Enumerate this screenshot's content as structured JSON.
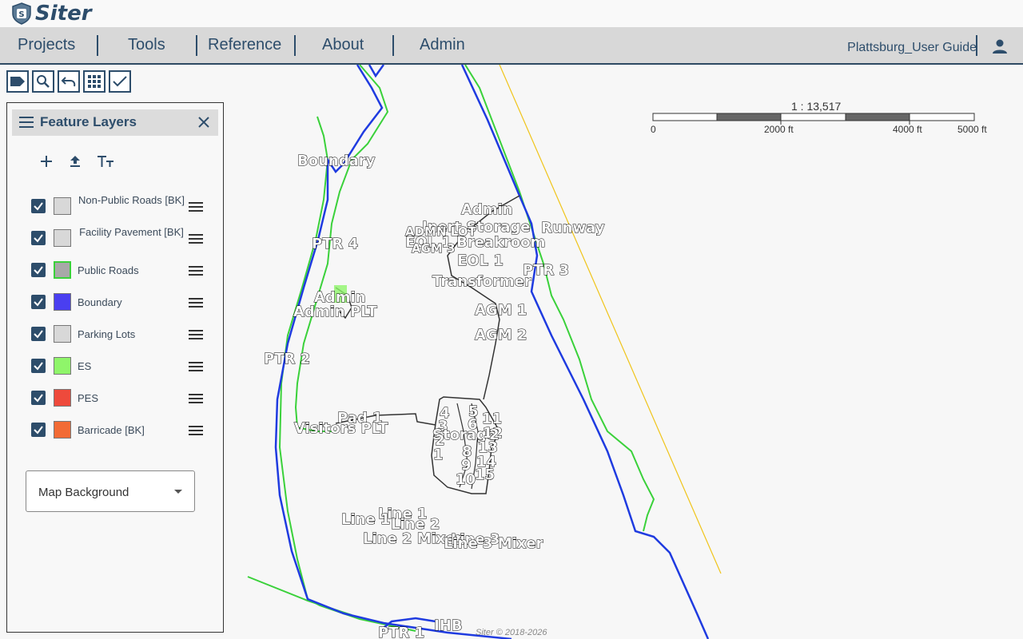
{
  "app": {
    "name": "Siter"
  },
  "nav": {
    "items": [
      {
        "id": "projects",
        "label": "Projects"
      },
      {
        "id": "tools",
        "label": "Tools"
      },
      {
        "id": "reference",
        "label": "Reference"
      },
      {
        "id": "about",
        "label": "About"
      },
      {
        "id": "admin",
        "label": "Admin"
      }
    ],
    "guide": "Plattsburg_User Guide"
  },
  "toolbar": {
    "icons": [
      "label-icon",
      "search-icon",
      "undo-icon",
      "grid-icon",
      "check-icon"
    ]
  },
  "panel": {
    "title": "Feature Layers",
    "layers": [
      {
        "label": "Non-Public Roads [BK]",
        "color": "#d8d8d8",
        "checked": true
      },
      {
        "label": "Facility Pavement [BK]",
        "color": "#d8d8d8",
        "checked": true
      },
      {
        "label": "Public Roads",
        "color": "#a8a8a8",
        "border": "#3ad13a",
        "checked": true
      },
      {
        "label": "Boundary",
        "color": "#4a3ff0",
        "checked": true
      },
      {
        "label": "Parking Lots",
        "color": "#d8d8d8",
        "checked": true
      },
      {
        "label": "ES",
        "color": "#8ff56a",
        "checked": true
      },
      {
        "label": "PES",
        "color": "#ee4a3c",
        "checked": true
      },
      {
        "label": "Barricade [BK]",
        "color": "#f26b35",
        "checked": true
      }
    ],
    "background_select": "Map Background"
  },
  "scale": {
    "ratio": "1 : 13,517",
    "labels": [
      "0",
      "2000 ft",
      "4000 ft",
      "5000 ft"
    ]
  },
  "map": {
    "labels": [
      "Boundary",
      "Admin",
      "Inert Storage",
      "Runway",
      "ADMN LOT",
      "EOL 1 Breakroom",
      "AGM 3",
      "EOL 1",
      "PTR 4",
      "PTR 3",
      "Transformer",
      "Admin",
      "Admin PLT",
      "AGM 1",
      "AGM 2",
      "PTR 2",
      "Pad 1",
      "Visitors PLT",
      "4",
      "5",
      "6",
      "11",
      "3",
      "Storage",
      "2",
      "12",
      "2",
      "8",
      "13",
      "1",
      "9",
      "14",
      "10",
      "15",
      "Line 1",
      "Line 1",
      "Line 2",
      "Line 2 Mixer",
      "Line 3",
      "Line 3 Mixer",
      "PTR 1",
      "IHB"
    ],
    "footer": "Siter © 2018-2026"
  },
  "colors": {
    "brand": "#2d4d6b",
    "boundary": "#1f3be0",
    "public_road": "#3ad13a",
    "runway": "#f0c419"
  }
}
